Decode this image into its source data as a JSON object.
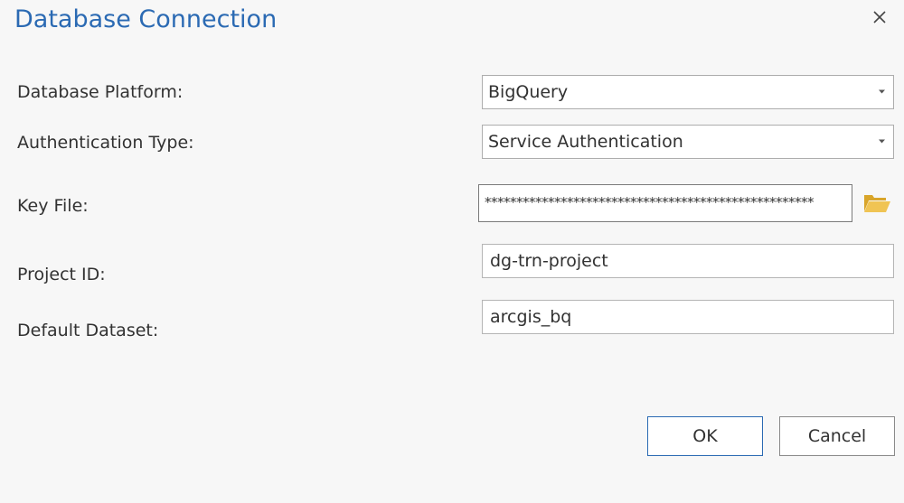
{
  "dialog": {
    "title": "Database Connection",
    "close_icon": "close-icon"
  },
  "fields": {
    "platform": {
      "label": "Database Platform:",
      "value": "BigQuery"
    },
    "auth": {
      "label": "Authentication Type:",
      "value": "Service Authentication"
    },
    "key_file": {
      "label": "Key File:",
      "value": "****************************************************",
      "browse_icon": "folder-open-icon"
    },
    "project_id": {
      "label": "Project ID:",
      "value": "dg-trn-project"
    },
    "dataset": {
      "label": "Default Dataset:",
      "value": "arcgis_bq"
    }
  },
  "buttons": {
    "ok": "OK",
    "cancel": "Cancel"
  },
  "colors": {
    "title": "#2b6ab3",
    "ok_border": "#2b6ab3",
    "folder": "#e8b93a",
    "background": "#f7f7f7"
  }
}
